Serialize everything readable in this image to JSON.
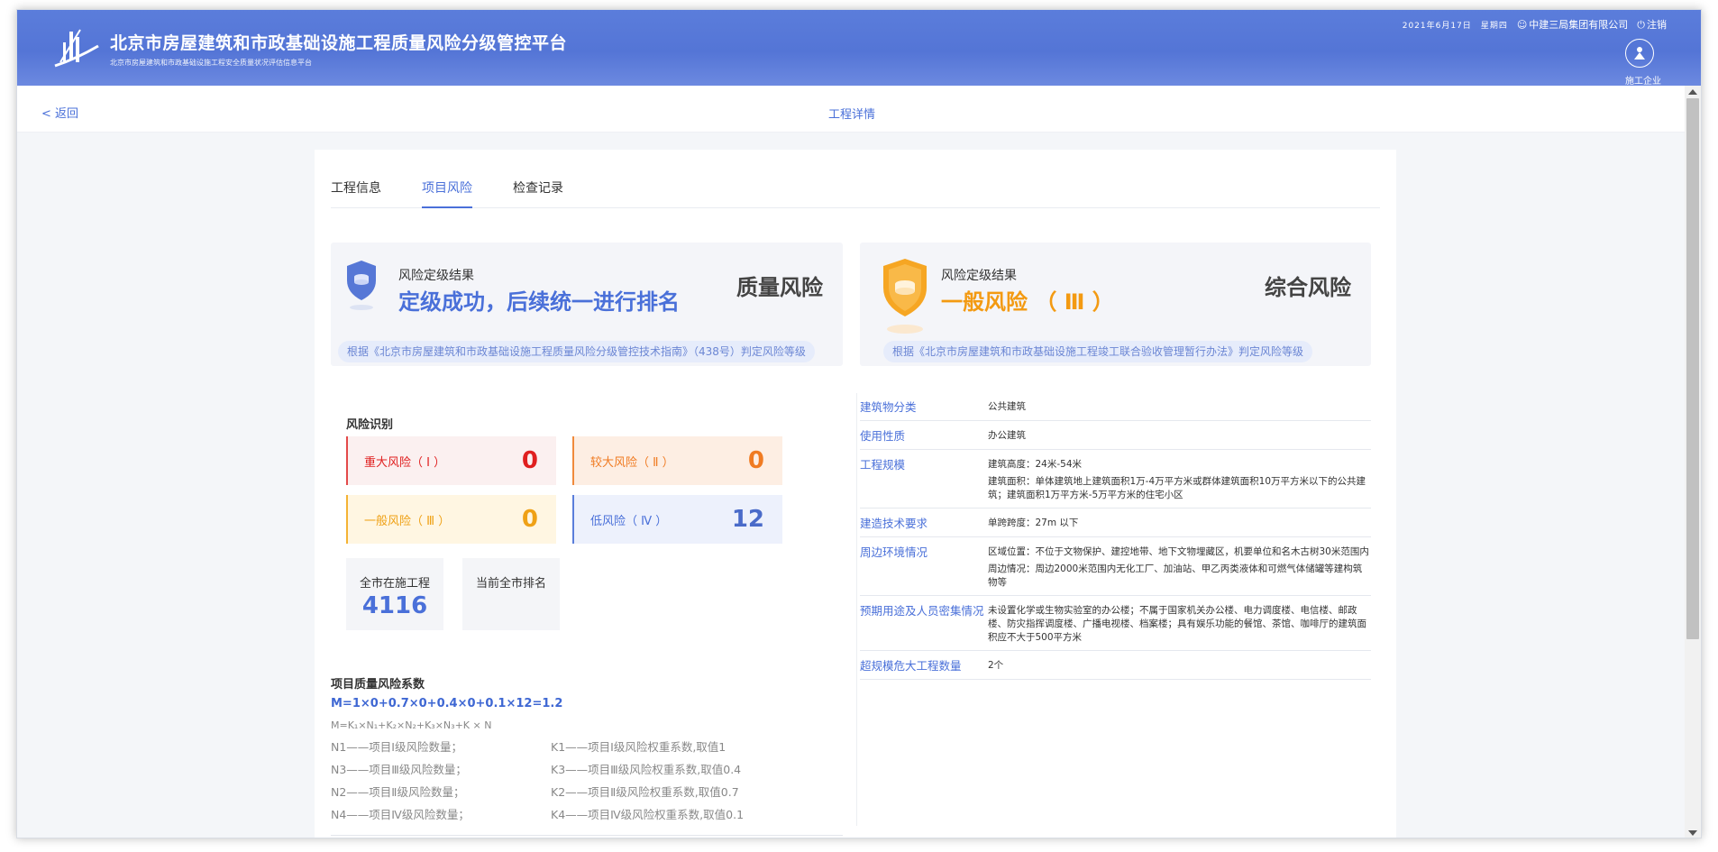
{
  "header": {
    "title": "北京市房屋建筑和市政基础设施工程质量风险分级管控平台",
    "subtitle": "北京市房屋建筑和市政基础设施工程安全质量状况评估信息平台",
    "date": "2021年6月17日",
    "weekday": "星期四",
    "user": "中建三局集团有限公司",
    "logout": "注销",
    "role": "施工企业"
  },
  "subnav": {
    "back": "< 返回",
    "title": "工程详情"
  },
  "tabs": [
    {
      "label": "工程信息",
      "active": false
    },
    {
      "label": "项目风险",
      "active": true
    },
    {
      "label": "检查记录",
      "active": false
    }
  ],
  "quality_result": {
    "label": "风险定级结果",
    "value": "定级成功，后续统一进行排名",
    "type": "质量风险",
    "note": "根据《北京市房屋建筑和市政基础设施工程质量风险分级管控技术指南》（438号）判定风险等级",
    "color": "#4a70d9"
  },
  "overall_result": {
    "label": "风险定级结果",
    "value": "一般风险 （ Ⅲ ）",
    "type": "综合风险",
    "note": "根据《北京市房屋建筑和市政基础设施工程竣工联合验收管理暂行办法》判定风险等级",
    "color": "#f39a12"
  },
  "risk_identification": {
    "title": "风险识别",
    "items": [
      {
        "name": "重大风险（ Ⅰ ）",
        "count": "0"
      },
      {
        "name": "较大风险（ Ⅱ ）",
        "count": "0"
      },
      {
        "name": "一般风险（ Ⅲ ）",
        "count": "0"
      },
      {
        "name": "低风险（ Ⅳ ）",
        "count": "12"
      }
    ]
  },
  "stats": {
    "city_label": "全市在施工程",
    "city_value": "4116",
    "rank_label": "当前全市排名",
    "rank_value": ""
  },
  "coefficient": {
    "title": "项目质量风险系数",
    "formula": "M=1×0+0.7×0+0.4×0+0.1×12=1.2",
    "general": "M=K₁×N₁+K₂×N₂+K₃×N₃+K × N",
    "legend": [
      {
        "n": "N1——项目Ⅰ级风险数量；",
        "k": "K1——项目Ⅰ级风险权重系数,取值1"
      },
      {
        "n": "N3——项目Ⅲ级风险数量；",
        "k": "K3——项目Ⅲ级风险权重系数,取值0.4"
      },
      {
        "n": "N2——项目Ⅱ级风险数量；",
        "k": "K2——项目Ⅱ级风险权重系数,取值0.7"
      },
      {
        "n": "N4——项目Ⅳ级风险数量；",
        "k": "K4——项目Ⅳ级风险权重系数,取值0.1"
      }
    ]
  },
  "properties": [
    {
      "key": "建筑物分类",
      "values": [
        "公共建筑"
      ]
    },
    {
      "key": "使用性质",
      "values": [
        "办公建筑"
      ]
    },
    {
      "key": "工程规模",
      "values": [
        "建筑高度：24米-54米",
        "建筑面积：单体建筑地上建筑面积1万-4万平方米或群体建筑面积10万平方米以下的公共建筑；建筑面积1万平方米-5万平方米的住宅小区"
      ]
    },
    {
      "key": "建造技术要求",
      "values": [
        "单跨跨度：27m 以下"
      ]
    },
    {
      "key": "周边环境情况",
      "values": [
        "区域位置：不位于文物保护、建控地带、地下文物埋藏区，机要单位和名木古树30米范围内",
        "周边情况：周边2000米范围内无化工厂、加油站、甲乙丙类液体和可燃气体储罐等建构筑物等"
      ]
    },
    {
      "key": "预期用途及人员密集情况",
      "values": [
        "未设置化学或生物实验室的办公楼；不属于国家机关办公楼、电力调度楼、电信楼、邮政楼、防灾指挥调度楼、广播电视楼、档案楼；具有娱乐功能的餐馆、茶馆、咖啡厅的建筑面积应不大于500平方米"
      ]
    },
    {
      "key": "超规模危大工程数量",
      "values": [
        "2个"
      ]
    }
  ]
}
